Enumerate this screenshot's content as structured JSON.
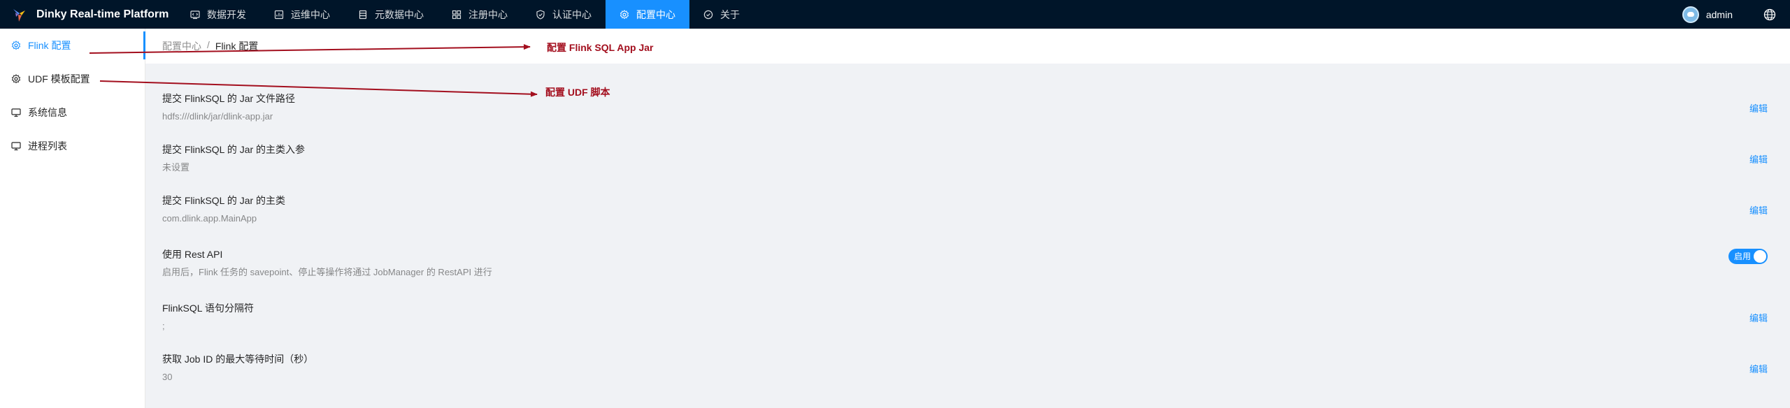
{
  "app": {
    "title": "Dinky Real-time Platform"
  },
  "nav": {
    "items": [
      {
        "label": "数据开发",
        "icon": "code-icon"
      },
      {
        "label": "运维中心",
        "icon": "ops-icon"
      },
      {
        "label": "元数据中心",
        "icon": "database-icon"
      },
      {
        "label": "注册中心",
        "icon": "registry-icon"
      },
      {
        "label": "认证中心",
        "icon": "shield-icon"
      },
      {
        "label": "配置中心",
        "icon": "gear-icon",
        "active": true
      },
      {
        "label": "关于",
        "icon": "info-icon"
      }
    ]
  },
  "user": {
    "name": "admin"
  },
  "sidebar": {
    "items": [
      {
        "label": "Flink 配置",
        "icon": "gear-icon",
        "active": true
      },
      {
        "label": "UDF 模板配置",
        "icon": "gear-icon"
      },
      {
        "label": "系统信息",
        "icon": "monitor-icon"
      },
      {
        "label": "进程列表",
        "icon": "monitor-icon"
      }
    ]
  },
  "breadcrumb": {
    "parent": "配置中心",
    "separator": "/",
    "current": "Flink 配置"
  },
  "settings": [
    {
      "title": "提交 FlinkSQL 的 Jar 文件路径",
      "value": "hdfs:///dlink/jar/dlink-app.jar",
      "action": "编辑"
    },
    {
      "title": "提交 FlinkSQL 的 Jar 的主类入参",
      "value": "未设置",
      "action": "编辑"
    },
    {
      "title": "提交 FlinkSQL 的 Jar 的主类",
      "value": "com.dlink.app.MainApp",
      "action": "编辑"
    },
    {
      "title": "使用 Rest API",
      "value": "启用后，Flink 任务的 savepoint、停止等操作将通过 JobManager 的 RestAPI 进行",
      "toggle_label": "启用",
      "toggle_on": true
    },
    {
      "title": "FlinkSQL 语句分隔符",
      "value": ";",
      "action": "编辑"
    },
    {
      "title": "获取 Job ID 的最大等待时间（秒）",
      "value": "30",
      "action": "编辑"
    }
  ],
  "annotations": [
    {
      "label": "配置 Flink SQL App Jar"
    },
    {
      "label": "配置 UDF 脚本"
    }
  ],
  "colors": {
    "header_bg": "#001529",
    "accent": "#1890ff",
    "annotation": "#a30f1e",
    "content_bg": "#f0f2f5"
  }
}
